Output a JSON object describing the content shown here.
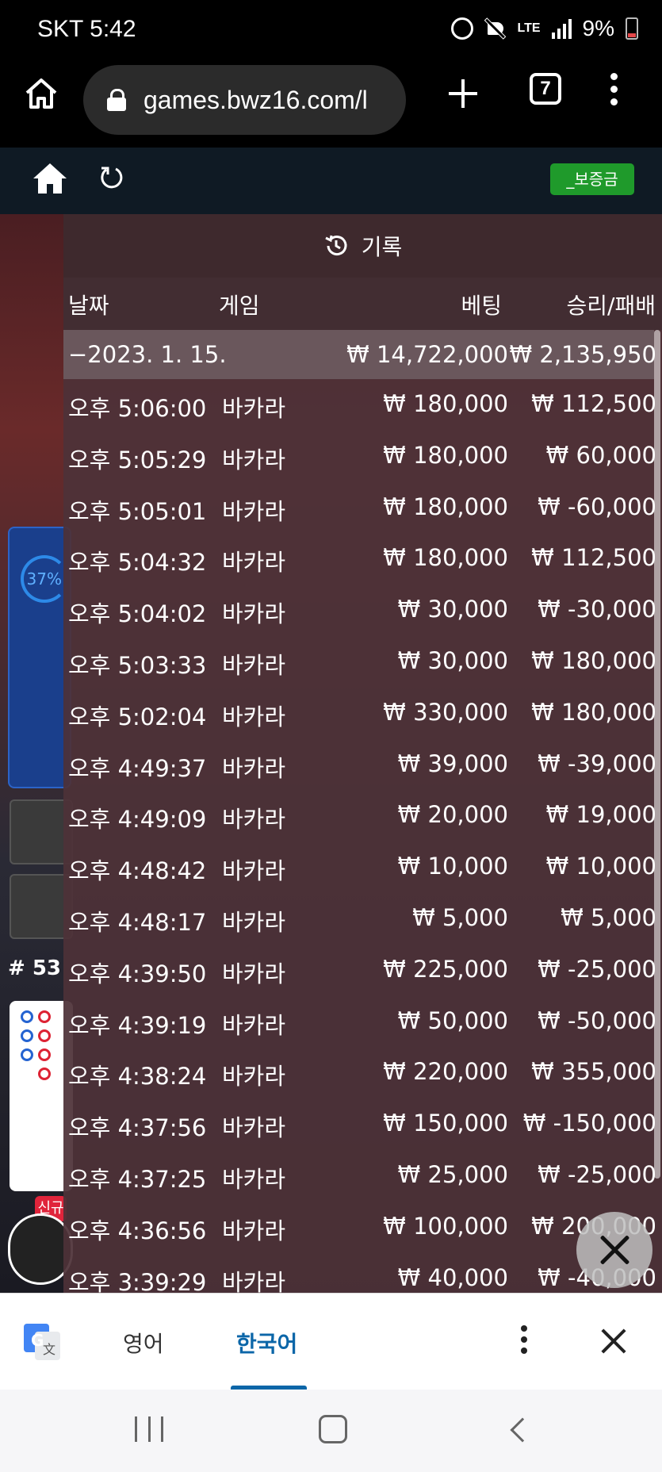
{
  "status": {
    "carrier_time": "SKT 5:42",
    "network": "LTE",
    "battery": "9%"
  },
  "browser": {
    "url": "games.bwz16.com/l",
    "tab_count": "7"
  },
  "site": {
    "deposit_label": "_보증금"
  },
  "background": {
    "percent": "37%",
    "round_count": "# 53",
    "new_badge": "신규"
  },
  "history": {
    "title": "기록",
    "columns": {
      "date": "날짜",
      "game": "게임",
      "bet": "베팅",
      "win_loss": "승리/패배"
    },
    "summary": {
      "date": "−2023. 1. 15.",
      "bet": "₩ 14,722,000",
      "win_loss": "₩ 2,135,950"
    },
    "rows": [
      {
        "time": "오후 5:06:00",
        "game": "바카라",
        "bet": "₩ 180,000",
        "win_loss": "₩ 112,500"
      },
      {
        "time": "오후 5:05:29",
        "game": "바카라",
        "bet": "₩ 180,000",
        "win_loss": "₩ 60,000"
      },
      {
        "time": "오후 5:05:01",
        "game": "바카라",
        "bet": "₩ 180,000",
        "win_loss": "₩ -60,000"
      },
      {
        "time": "오후 5:04:32",
        "game": "바카라",
        "bet": "₩ 180,000",
        "win_loss": "₩ 112,500"
      },
      {
        "time": "오후 5:04:02",
        "game": "바카라",
        "bet": "₩ 30,000",
        "win_loss": "₩ -30,000"
      },
      {
        "time": "오후 5:03:33",
        "game": "바카라",
        "bet": "₩ 30,000",
        "win_loss": "₩ 180,000"
      },
      {
        "time": "오후 5:02:04",
        "game": "바카라",
        "bet": "₩ 330,000",
        "win_loss": "₩ 180,000"
      },
      {
        "time": "오후 4:49:37",
        "game": "바카라",
        "bet": "₩ 39,000",
        "win_loss": "₩ -39,000"
      },
      {
        "time": "오후 4:49:09",
        "game": "바카라",
        "bet": "₩ 20,000",
        "win_loss": "₩ 19,000"
      },
      {
        "time": "오후 4:48:42",
        "game": "바카라",
        "bet": "₩ 10,000",
        "win_loss": "₩ 10,000"
      },
      {
        "time": "오후 4:48:17",
        "game": "바카라",
        "bet": "₩ 5,000",
        "win_loss": "₩ 5,000"
      },
      {
        "time": "오후 4:39:50",
        "game": "바카라",
        "bet": "₩ 225,000",
        "win_loss": "₩ -25,000"
      },
      {
        "time": "오후 4:39:19",
        "game": "바카라",
        "bet": "₩ 50,000",
        "win_loss": "₩ -50,000"
      },
      {
        "time": "오후 4:38:24",
        "game": "바카라",
        "bet": "₩ 220,000",
        "win_loss": "₩ 355,000"
      },
      {
        "time": "오후 4:37:56",
        "game": "바카라",
        "bet": "₩ 150,000",
        "win_loss": "₩ -150,000"
      },
      {
        "time": "오후 4:37:25",
        "game": "바카라",
        "bet": "₩ 25,000",
        "win_loss": "₩ -25,000"
      },
      {
        "time": "오후 4:36:56",
        "game": "바카라",
        "bet": "₩ 100,000",
        "win_loss": "₩ 200,000"
      },
      {
        "time": "오후 3:39:29",
        "game": "바카라",
        "bet": "₩ 40,000",
        "win_loss": "₩ -40,000"
      }
    ]
  },
  "translate": {
    "source_lang": "영어",
    "target_lang": "한국어"
  },
  "colors": {
    "deposit_green": "#1f9a2b",
    "translate_accent": "#0b66a8",
    "panel_bg": "#4e3238"
  }
}
